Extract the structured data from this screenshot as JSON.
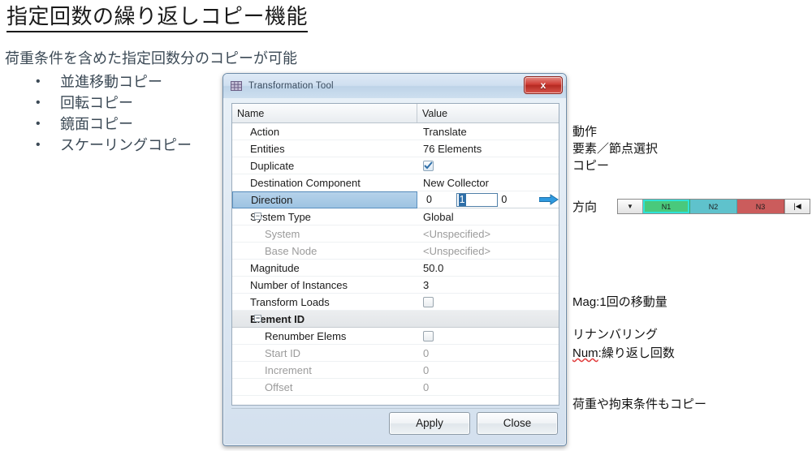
{
  "slide": {
    "title": "指定回数の繰り返しコピー機能",
    "subtitle": "荷重条件を含めた指定回数分のコピーが可能",
    "bullet_char": "•",
    "bullets": [
      "並進移動コピー",
      "回転コピー",
      "鏡面コピー",
      "スケーリングコピー"
    ]
  },
  "annotations": {
    "group1": "動作\n要素／節点選択\nコピー",
    "direction_label": "方向",
    "group2_line1_pre": "Mag:",
    "group2_line1": "Mag:1回の移動量",
    "group2_line2_spell": "Num",
    "group2_line2_rest": ":繰り返し回数",
    "group2_line3": "荷重や拘束条件もコピー",
    "group3": "リナンバリング"
  },
  "node_bar": {
    "dropdown_glyph": "▼",
    "end_glyph": "|◀",
    "cells": [
      {
        "label": "N1",
        "color": "#49c97c",
        "selected": true
      },
      {
        "label": "N2",
        "color": "#5fc2cc",
        "selected": false
      },
      {
        "label": "N3",
        "color": "#cb5c5c",
        "selected": false
      }
    ]
  },
  "dialog": {
    "title": "Transformation Tool",
    "icon": "mesh-grid-icon",
    "close_label": "x",
    "columns": {
      "name": "Name",
      "value": "Value"
    },
    "rows": [
      {
        "name": "Action",
        "value": "Translate",
        "indent": 1,
        "type": "text"
      },
      {
        "name": "Entities",
        "value": "76 Elements",
        "indent": 1,
        "type": "text"
      },
      {
        "name": "Duplicate",
        "value": "",
        "indent": 1,
        "type": "checkbox",
        "checked": true
      },
      {
        "name": "Destination Component",
        "value": "New Collector",
        "indent": 1,
        "type": "text"
      },
      {
        "name": "Direction",
        "value": "",
        "indent": 1,
        "type": "direction",
        "selected": true,
        "fields": [
          "0",
          "1",
          "0"
        ],
        "active_field": 1,
        "arrow": "⇒"
      },
      {
        "name": "System Type",
        "value": "Global",
        "indent": 1,
        "type": "text",
        "twisty": "−"
      },
      {
        "name": "System",
        "value": "<Unspecified>",
        "indent": 2,
        "type": "text",
        "disabled": true
      },
      {
        "name": "Base Node",
        "value": "<Unspecified>",
        "indent": 2,
        "type": "text",
        "disabled": true
      },
      {
        "name": "Magnitude",
        "value": "50.0",
        "indent": 1,
        "type": "text"
      },
      {
        "name": "Number of Instances",
        "value": "3",
        "indent": 1,
        "type": "text"
      },
      {
        "name": "Transform Loads",
        "value": "",
        "indent": 1,
        "type": "checkbox",
        "checked": false
      },
      {
        "name": "Element ID",
        "value": "",
        "indent": 1,
        "type": "group",
        "twisty": "−"
      },
      {
        "name": "Renumber Elems",
        "value": "",
        "indent": 2,
        "type": "checkbox",
        "checked": false
      },
      {
        "name": "Start ID",
        "value": "0",
        "indent": 2,
        "type": "text",
        "disabled": true
      },
      {
        "name": "Increment",
        "value": "0",
        "indent": 2,
        "type": "text",
        "disabled": true
      },
      {
        "name": "Offset",
        "value": "0",
        "indent": 2,
        "type": "text",
        "disabled": true
      }
    ],
    "buttons": {
      "apply": "Apply",
      "close": "Close"
    }
  },
  "colors": {
    "accent_blue": "#2f6fa8",
    "selection_row": "#9dc3e2",
    "close_red": "#cf3d35",
    "spell_underline": "#e03b3b",
    "node_n1": "#49c97c",
    "node_n2": "#5fc2cc",
    "node_n3": "#cb5c5c"
  }
}
